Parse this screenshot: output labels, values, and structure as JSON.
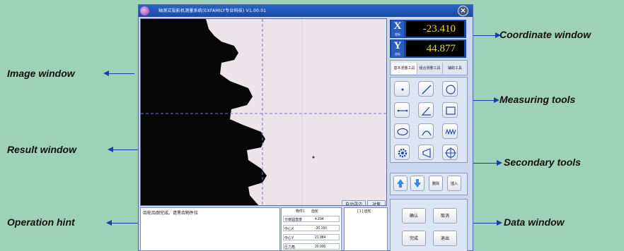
{
  "callouts": {
    "coordinate": "Coordinate window",
    "image": "Image window",
    "measuring": "Measuring tools",
    "result": "Result window",
    "secondary": "Secondary tools",
    "operation": "Operation hint",
    "data": "Data window"
  },
  "window": {
    "title": "轴测式投影机测量系统(EXFAMILY专业科技) V1.00.01"
  },
  "coordinates": {
    "x_label": "X",
    "x_sub": "坐标",
    "x_value": "-23.410",
    "y_label": "Y",
    "y_sub": "坐标",
    "y_value": "44.877"
  },
  "tabs": [
    "基本测量工具",
    "组合测量工具",
    "辅助工具"
  ],
  "tools": [
    {
      "icon": "point-icon"
    },
    {
      "icon": "line-icon"
    },
    {
      "icon": "circle-icon"
    },
    {
      "icon": "distance-icon"
    },
    {
      "icon": "angle-icon"
    },
    {
      "icon": "rectangle-icon"
    },
    {
      "icon": "ellipse-icon"
    },
    {
      "icon": "arc-icon"
    },
    {
      "icon": "thread-icon"
    },
    {
      "icon": "gear-icon"
    },
    {
      "icon": "cone-icon"
    },
    {
      "icon": "crosshair-icon"
    }
  ],
  "secondary": {
    "up_icon": "arrow-up-icon",
    "down_icon": "arrow-down-icon",
    "delete_label": "删除",
    "insert_label": "插入"
  },
  "image_buttons": {
    "auto_label": "自动寻边",
    "fit_label": "对焦"
  },
  "hint": {
    "text": "齿轮齿廓完成。请黑齿物件拉"
  },
  "result": {
    "header_left": "物件1",
    "header_right": "齿轮",
    "rows": [
      {
        "name": "分度圆直度",
        "value": "4.234"
      },
      {
        "name": "中心X",
        "value": "-30.150"
      },
      {
        "name": "中心Y",
        "value": "21.984"
      },
      {
        "name": "压力角",
        "value": "20.000"
      }
    ]
  },
  "data": {
    "text": "[ 1 ] 齿轮"
  },
  "actions": {
    "confirm": "确认",
    "cancel": "取消",
    "finish": "完成",
    "exit": "退出"
  }
}
